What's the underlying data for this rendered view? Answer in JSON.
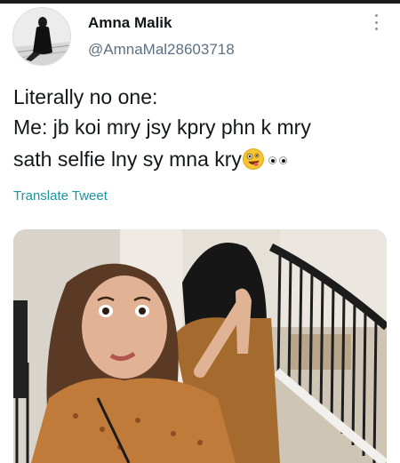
{
  "tweet": {
    "display_name": "Amna Malik",
    "handle": "@AmnaMal28603718",
    "text_lines": [
      "Literally no one:",
      "Me: jb koi mry jsy kpry phn k mry",
      "sath selfie lny sy mna kry"
    ],
    "emojis": [
      "zany-face-emoji",
      "eyes-emoji"
    ],
    "translate_label": "Translate Tweet"
  },
  "icons": {
    "more": "vertical-ellipsis-icon"
  },
  "colors": {
    "text": "#14171a",
    "secondary": "#5b7083",
    "link": "#1b95a0"
  }
}
